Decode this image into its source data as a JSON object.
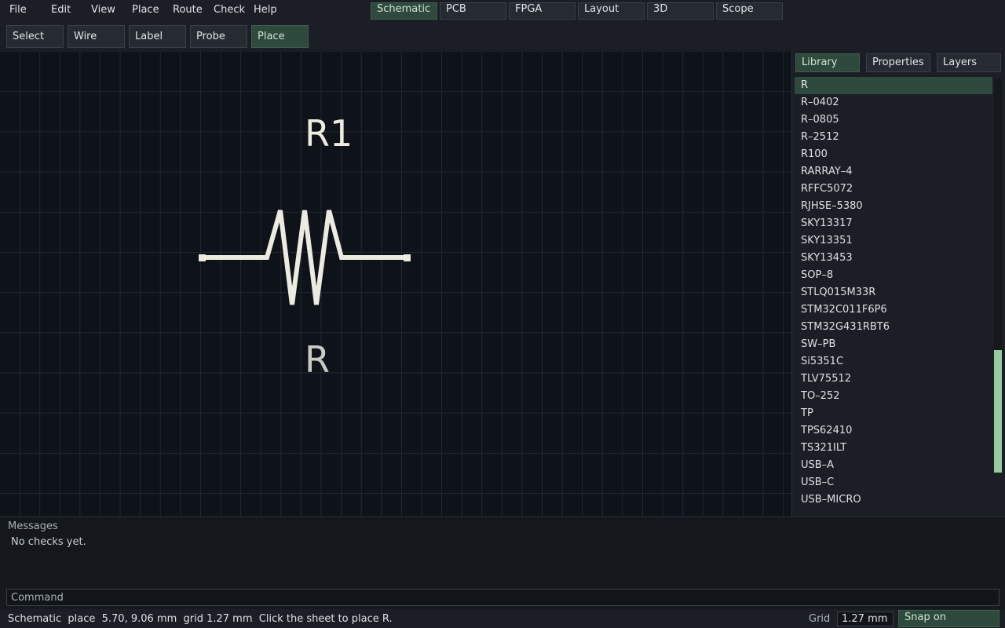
{
  "menu": [
    "File",
    "Edit",
    "View",
    "Place",
    "Route",
    "Check",
    "Help"
  ],
  "mode_tabs": {
    "items": [
      "Schematic",
      "PCB",
      "FPGA",
      "Layout",
      "3D",
      "Scope"
    ],
    "active": "Schematic"
  },
  "toolbar": {
    "items": [
      "Select",
      "Wire",
      "Label",
      "Probe",
      "Place"
    ],
    "active": "Place"
  },
  "canvas": {
    "component": {
      "designator": "R1",
      "value": "R",
      "symbol_icon": "resistor-zigzag-icon",
      "stroke_color": "#ecebdf"
    }
  },
  "panel": {
    "tabs": [
      "Library",
      "Properties",
      "Layers"
    ],
    "active_tab": "Library",
    "library_items": [
      "R",
      "R–0402",
      "R–0805",
      "R–2512",
      "R100",
      "RARRAY–4",
      "RFFC5072",
      "RJHSE–5380",
      "SKY13317",
      "SKY13351",
      "SKY13453",
      "SOP–8",
      "STLQ015M33R",
      "STM32C011F6P6",
      "STM32G431RBT6",
      "SW–PB",
      "Si5351C",
      "TLV75512",
      "TO–252",
      "TP",
      "TPS62410",
      "TS321ILT",
      "USB–A",
      "USB–C",
      "USB–MICRO"
    ],
    "selected_item": "R",
    "scroll": {
      "start_fraction": 0.69,
      "visible_fraction": 0.31
    }
  },
  "messages": {
    "title": "Messages",
    "body": "No checks yet."
  },
  "command": {
    "placeholder": "Command"
  },
  "status": {
    "text": "Schematic  place  5.70, 9.06 mm  grid 1.27 mm  Click the sheet to place R.",
    "grid_label": "Grid",
    "grid_value": "1.27 mm",
    "snap_label": "Snap on"
  },
  "colors": {
    "accent": "#2e4a3c",
    "scroll_thumb": "#98c9a0",
    "canvas_bg": "#0e1219"
  }
}
